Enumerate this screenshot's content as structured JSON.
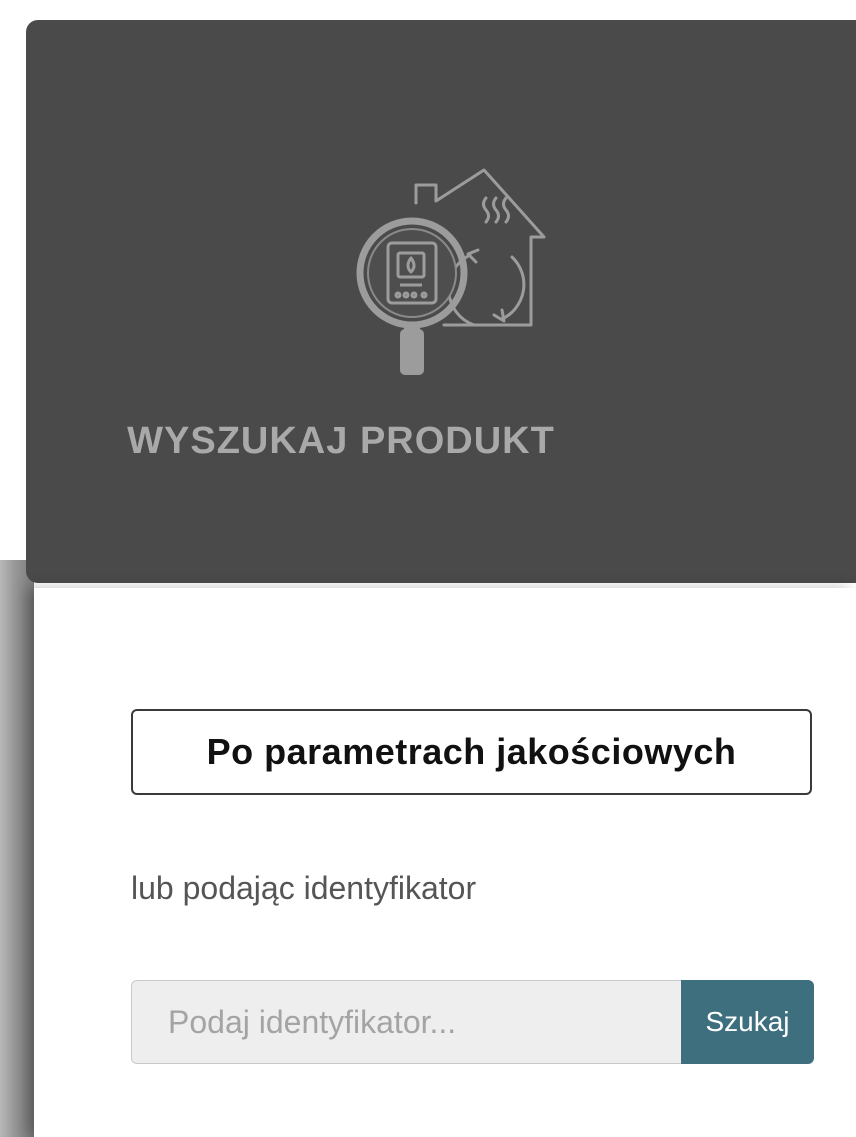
{
  "header": {
    "title": "WYSZUKAJ PRODUKT",
    "icon": "product-search-house-icon"
  },
  "body": {
    "param_button_label": "Po parametrach jakościowych",
    "or_label": "lub podając identyfikator",
    "search": {
      "placeholder": "Podaj identyfikator...",
      "value": "",
      "button_label": "Szukaj"
    }
  },
  "colors": {
    "header_bg": "#4a4a4a",
    "header_text": "#a9a9a9",
    "search_button": "#3e6f7e"
  }
}
